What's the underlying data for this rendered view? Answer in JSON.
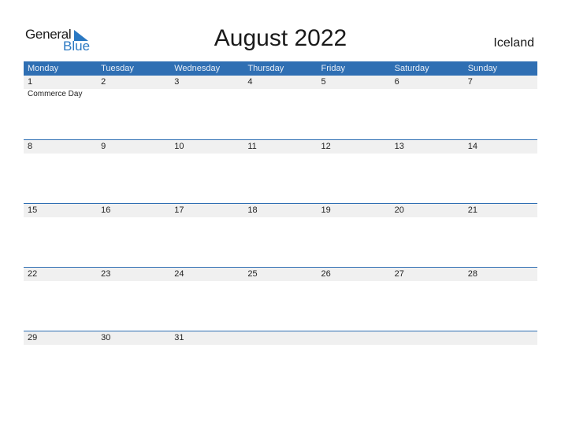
{
  "logo": {
    "word1": "General",
    "word2": "Blue"
  },
  "title": "August 2022",
  "country": "Iceland",
  "colors": {
    "accent": "#2f6fb3",
    "strip": "#f0f0f0",
    "logo_blue": "#2a78c2"
  },
  "weekdays": [
    "Monday",
    "Tuesday",
    "Wednesday",
    "Thursday",
    "Friday",
    "Saturday",
    "Sunday"
  ],
  "weeks": [
    {
      "days": [
        "1",
        "2",
        "3",
        "4",
        "5",
        "6",
        "7"
      ],
      "events": [
        "Commerce Day",
        "",
        "",
        "",
        "",
        "",
        ""
      ]
    },
    {
      "days": [
        "8",
        "9",
        "10",
        "11",
        "12",
        "13",
        "14"
      ],
      "events": [
        "",
        "",
        "",
        "",
        "",
        "",
        ""
      ]
    },
    {
      "days": [
        "15",
        "16",
        "17",
        "18",
        "19",
        "20",
        "21"
      ],
      "events": [
        "",
        "",
        "",
        "",
        "",
        "",
        ""
      ]
    },
    {
      "days": [
        "22",
        "23",
        "24",
        "25",
        "26",
        "27",
        "28"
      ],
      "events": [
        "",
        "",
        "",
        "",
        "",
        "",
        ""
      ]
    },
    {
      "days": [
        "29",
        "30",
        "31",
        "",
        "",
        "",
        ""
      ],
      "events": [
        "",
        "",
        "",
        "",
        "",
        "",
        ""
      ]
    }
  ]
}
